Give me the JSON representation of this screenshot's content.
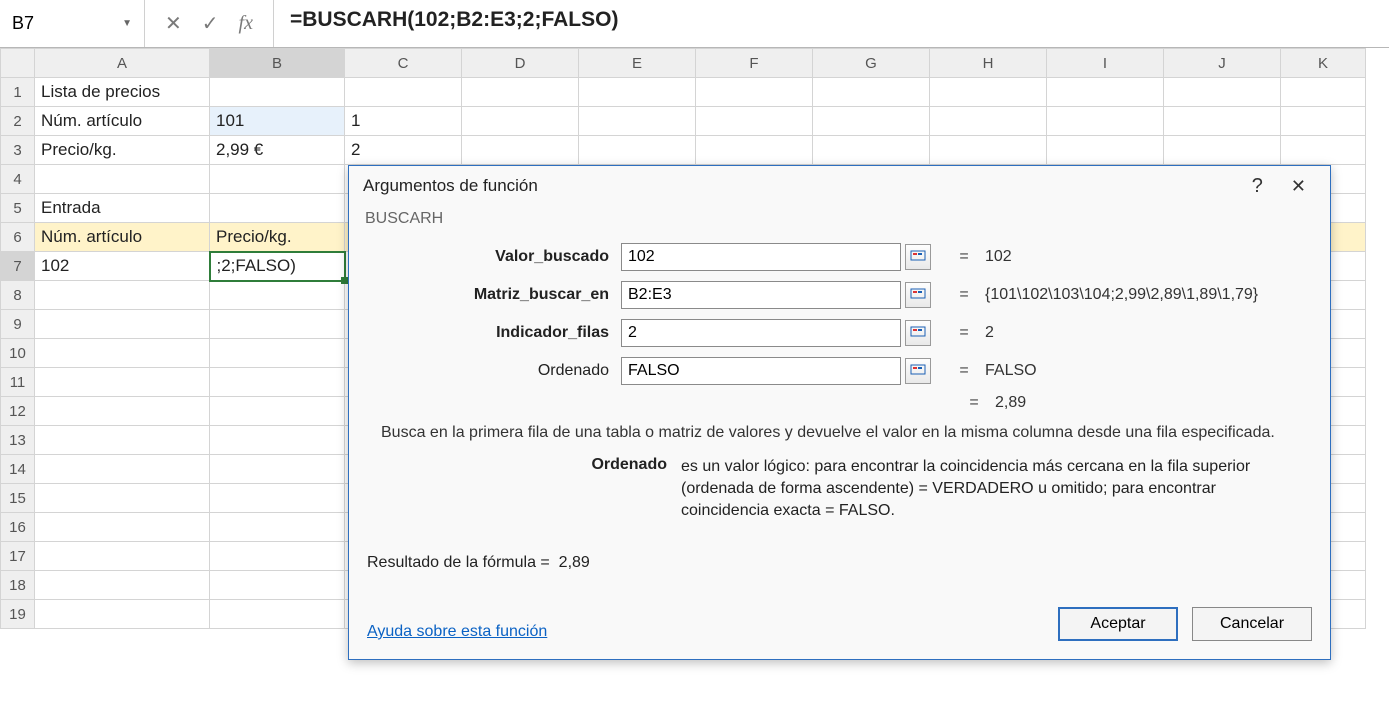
{
  "formula_bar": {
    "name_box": "B7",
    "formula": "=BUSCARH(102;B2:E3;2;FALSO)"
  },
  "columns": [
    "A",
    "B",
    "C",
    "D",
    "E",
    "F",
    "G",
    "H",
    "I",
    "J",
    "K"
  ],
  "rows": [
    "1",
    "2",
    "3",
    "4",
    "5",
    "6",
    "7",
    "8",
    "9",
    "10",
    "11",
    "12",
    "13",
    "14",
    "15",
    "16",
    "17",
    "18",
    "19"
  ],
  "cells": {
    "A1": "Lista de precios",
    "A2": "Núm. artículo",
    "B2": "101",
    "C2": "1",
    "A3": "Precio/kg.",
    "B3": "2,99 €",
    "C3": "2",
    "A5": "Entrada",
    "A6": "Núm. artículo",
    "B6": "Precio/kg.",
    "A7": "102",
    "B7": ";2;FALSO)"
  },
  "dialog": {
    "title": "Argumentos de función",
    "fn": "BUSCARH",
    "args": [
      {
        "label": "Valor_buscado",
        "bold": true,
        "value": "102",
        "result": "102"
      },
      {
        "label": "Matriz_buscar_en",
        "bold": true,
        "value": "B2:E3",
        "result": "{101\\102\\103\\104;2,99\\2,89\\1,89\\1,79}"
      },
      {
        "label": "Indicador_filas",
        "bold": true,
        "value": "2",
        "result": "2"
      },
      {
        "label": "Ordenado",
        "bold": false,
        "value": "FALSO",
        "result": "FALSO"
      }
    ],
    "final_result": "2,89",
    "description": "Busca en la primera fila de una tabla o matriz de valores y devuelve el valor en la misma columna desde una fila especificada.",
    "param_label": "Ordenado",
    "param_text": "es un valor lógico: para encontrar la coincidencia más cercana en la fila superior (ordenada de forma ascendente) = VERDADERO u omitido; para encontrar coincidencia exacta = FALSO.",
    "result_label": "Resultado de la fórmula =",
    "result_value": "2,89",
    "help_link": "Ayuda sobre esta función",
    "ok": "Aceptar",
    "cancel": "Cancelar"
  }
}
